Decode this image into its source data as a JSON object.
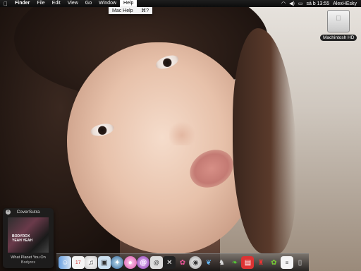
{
  "menubar": {
    "apple_icon": "apple-icon",
    "items": [
      "Finder",
      "File",
      "Edit",
      "View",
      "Go",
      "Window",
      "Help"
    ],
    "active_item": "Help",
    "status": {
      "clock": "sá b 13:55",
      "user": "AlexHEsky"
    }
  },
  "help_menu": {
    "item": "Mac Help",
    "shortcut": "⌘?"
  },
  "desktop": {
    "drive_label": "Machintosh HD"
  },
  "coversutra": {
    "title": "CoverSutra",
    "art_text": "BODYROX\nYEAH YEAH",
    "song": "What Planet You On",
    "artist": "Bodyrox"
  },
  "dock": {
    "icons": [
      "finder-icon",
      "ical-icon",
      "itunes-icon",
      "iphoto-icon",
      "safari-icon",
      "ichat-icon",
      "spiral-icon",
      "address-icon",
      "x11-icon",
      "flower-icon",
      "disk-icon",
      "feather-icon",
      "tool-icon",
      "leaf-icon",
      "photobooth-icon",
      "game-icon",
      "frog-icon",
      "textedit-icon",
      "trash-icon"
    ]
  }
}
